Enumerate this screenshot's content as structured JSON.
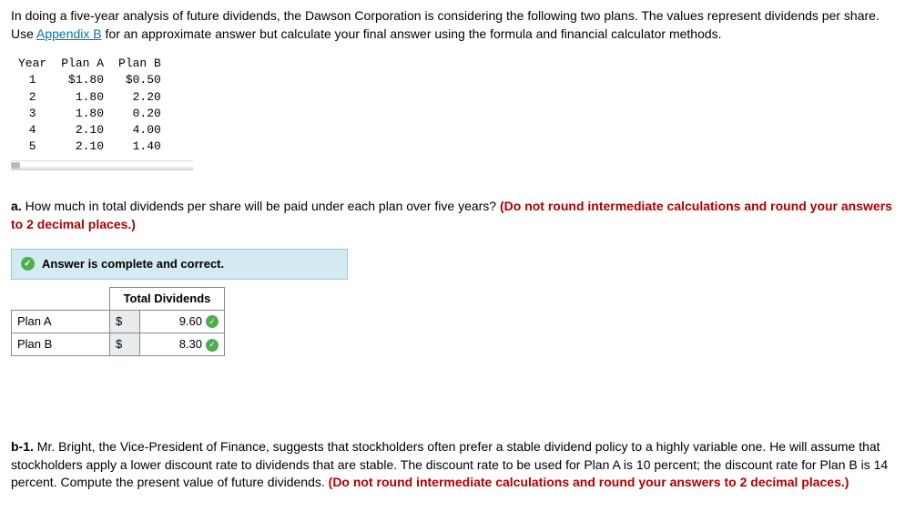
{
  "intro": {
    "part1": "In doing a five-year analysis of future dividends, the Dawson Corporation is considering the following two plans. The values represent dividends per share. Use ",
    "link_text": "Appendix B",
    "part2": " for an approximate answer but calculate your final answer using the formula and financial calculator methods."
  },
  "table": {
    "headers": {
      "year": "Year",
      "planA": "Plan A",
      "planB": "Plan B"
    },
    "rows": [
      {
        "year": "1",
        "a": "$1.80",
        "b": "$0.50"
      },
      {
        "year": "2",
        "a": "1.80",
        "b": "2.20"
      },
      {
        "year": "3",
        "a": "1.80",
        "b": "0.20"
      },
      {
        "year": "4",
        "a": "2.10",
        "b": "4.00"
      },
      {
        "year": "5",
        "a": "2.10",
        "b": "1.40"
      }
    ]
  },
  "section_a": {
    "label": "a.",
    "question": " How much in total dividends per share will be paid under each plan over five years? ",
    "note": "(Do not round intermediate calculations and round your answers to 2 decimal places.)"
  },
  "banner": {
    "text": "Answer is complete and correct."
  },
  "answer": {
    "header": "Total Dividends",
    "rows": [
      {
        "label": "Plan A",
        "currency": "$",
        "value": "9.60"
      },
      {
        "label": "Plan B",
        "currency": "$",
        "value": "8.30"
      }
    ]
  },
  "section_b": {
    "label": "b-1.",
    "question": " Mr. Bright, the Vice-President of Finance, suggests that stockholders often prefer a stable dividend policy to a highly variable one. He will assume that stockholders apply a lower discount rate to dividends that are stable. The discount rate to be used for Plan A is 10 percent; the discount rate for Plan B is 14 percent. Compute the present value of future dividends. ",
    "note": "(Do not round intermediate calculations and round your answers to 2 decimal places.)"
  }
}
